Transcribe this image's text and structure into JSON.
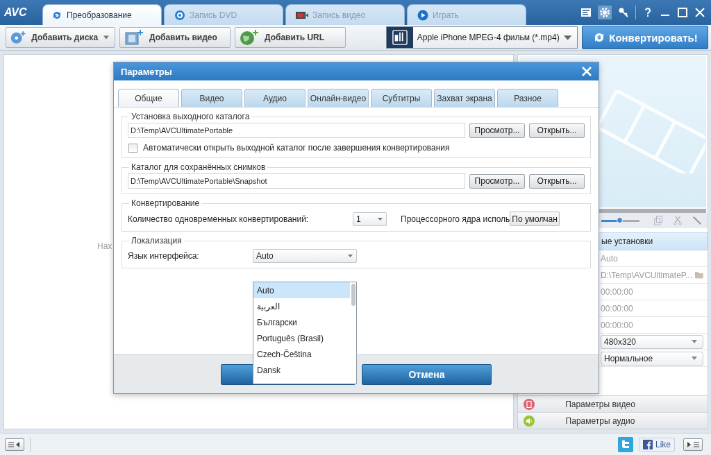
{
  "app": {
    "logo": "AVC"
  },
  "tabs": [
    {
      "label": "Преобразование",
      "selected": true
    },
    {
      "label": "Запись DVD",
      "selected": false
    },
    {
      "label": "Запись видео",
      "selected": false
    },
    {
      "label": "Играть",
      "selected": false
    }
  ],
  "toolbar": {
    "buttons": [
      {
        "label": "Добавить диска",
        "dropdown": true
      },
      {
        "label": "Добавить видео",
        "dropdown": false
      },
      {
        "label": "Добавить URL",
        "dropdown": false
      }
    ],
    "profile": "Apple iPhone MPEG-4 фильм (*.mp4)",
    "convert": "Конвертировать!"
  },
  "main": {
    "hint": "Нах"
  },
  "side_panel": {
    "zoom_slider": {
      "level": 0.5
    },
    "header": "ые установки",
    "rows": [
      {
        "kind": "text",
        "value": "Auto"
      },
      {
        "kind": "path",
        "value": "D:\\Temp\\AVCUltimateP..."
      },
      {
        "kind": "text",
        "value": "00:00:00"
      },
      {
        "kind": "text",
        "value": "00:00:00"
      },
      {
        "kind": "text",
        "value": "00:00:00"
      },
      {
        "kind": "select",
        "value": "480x320"
      },
      {
        "kind": "select",
        "value": "Нормальное"
      }
    ],
    "sections": [
      {
        "kind": "video",
        "label": "Параметры видео"
      },
      {
        "kind": "audio",
        "label": "Параметры аудио"
      }
    ]
  },
  "dialog": {
    "title": "Параметры",
    "tabs": [
      {
        "label": "Общие",
        "selected": true
      },
      {
        "label": "Видео",
        "selected": false
      },
      {
        "label": "Аудио",
        "selected": false
      },
      {
        "label": "Онлайн-видео",
        "selected": false
      },
      {
        "label": "Субтитры",
        "selected": false
      },
      {
        "label": "Захват экрана",
        "selected": false
      },
      {
        "label": "Разное",
        "selected": false
      }
    ],
    "output": {
      "legend": "Установка выходного каталога",
      "path": "D:\\Temp\\AVCUltimatePortable",
      "browse": "Просмотр...",
      "open": "Открыть...",
      "auto_open": {
        "label": "Автоматически открыть выходной каталог после завершения конвертирования",
        "checked": false
      }
    },
    "snapshots": {
      "legend": "Каталог для сохранённых снимков",
      "path": "D:\\Temp\\AVCUltimatePortable\\Snapshot",
      "browse": "Просмотр...",
      "open": "Открыть..."
    },
    "conversion": {
      "legend": "Конвертирование",
      "count_label": "Количество одновременных конвертирований:",
      "count_value": "1",
      "cores_label": "Процессорного ядра исполь",
      "cores_value": "По умолчан"
    },
    "localization": {
      "legend": "Локализация",
      "language_label": "Язык интерфейса:",
      "language_value": "Auto",
      "options": [
        {
          "label": "Auto",
          "selected": true
        },
        {
          "label": "العربية",
          "selected": false
        },
        {
          "label": "Български",
          "selected": false
        },
        {
          "label": "Português (Brasil)",
          "selected": false
        },
        {
          "label": "Czech-Čeština",
          "selected": false
        },
        {
          "label": "Dansk",
          "selected": false
        }
      ]
    },
    "cancel": "Отмена"
  },
  "status_bar": {
    "like": "Like"
  }
}
